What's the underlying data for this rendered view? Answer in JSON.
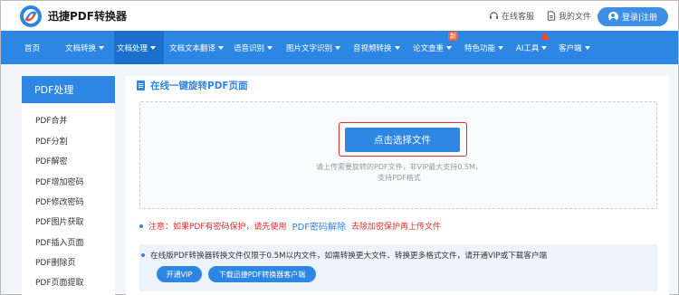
{
  "header": {
    "brand": "迅捷PDF转换器",
    "service_label": "在线客服",
    "files_label": "我的文件",
    "login_label": "登录|注册"
  },
  "nav": {
    "items": [
      {
        "label": "首页",
        "dropdown": false
      },
      {
        "label": "文档转换",
        "dropdown": true
      },
      {
        "label": "文档处理",
        "dropdown": true,
        "active": true
      },
      {
        "label": "文档文本翻译",
        "dropdown": true
      },
      {
        "label": "语音识别",
        "dropdown": true
      },
      {
        "label": "图片文字识别",
        "dropdown": true
      },
      {
        "label": "音视频转换",
        "dropdown": true
      },
      {
        "label": "论文查重",
        "dropdown": true
      },
      {
        "label": "特色功能",
        "dropdown": true
      },
      {
        "label": "AI工具",
        "dropdown": true
      },
      {
        "label": "客户端",
        "dropdown": true
      }
    ],
    "new_badge": "新"
  },
  "sidebar": {
    "title": "PDF处理",
    "items": [
      "PDF合并",
      "PDF分割",
      "PDF解密",
      "PDF增加密码",
      "PDF修改密码",
      "PDF图片获取",
      "PDF插入页面",
      "PDF删除页",
      "PDF页面提取"
    ]
  },
  "main": {
    "title": "在线一键旋转PDF页面",
    "select_button": "点击选择文件",
    "hint_line1": "请上传需要旋转的PDF文件，非VIP最大支持0.5M，",
    "hint_line2": "支持PDF格式",
    "notice_prefix": "注意：如果PDF有密码保护，请先使用",
    "notice_link": "PDF密码解除",
    "notice_suffix": "去除加密保护再上传文件",
    "info_text": "在线版PDF转换器转换文件仅限于0.5M以内文件，如需转换更大文件、转换更多格式文件，请开通VIP或下载客户端",
    "vip_button": "开通VIP",
    "download_button": "下载迅捷PDF转换器客户端"
  },
  "colors": {
    "primary": "#2e86e4",
    "nav_active": "#1c6fcc",
    "alert": "#e02d2d",
    "badge": "#f5633f"
  }
}
